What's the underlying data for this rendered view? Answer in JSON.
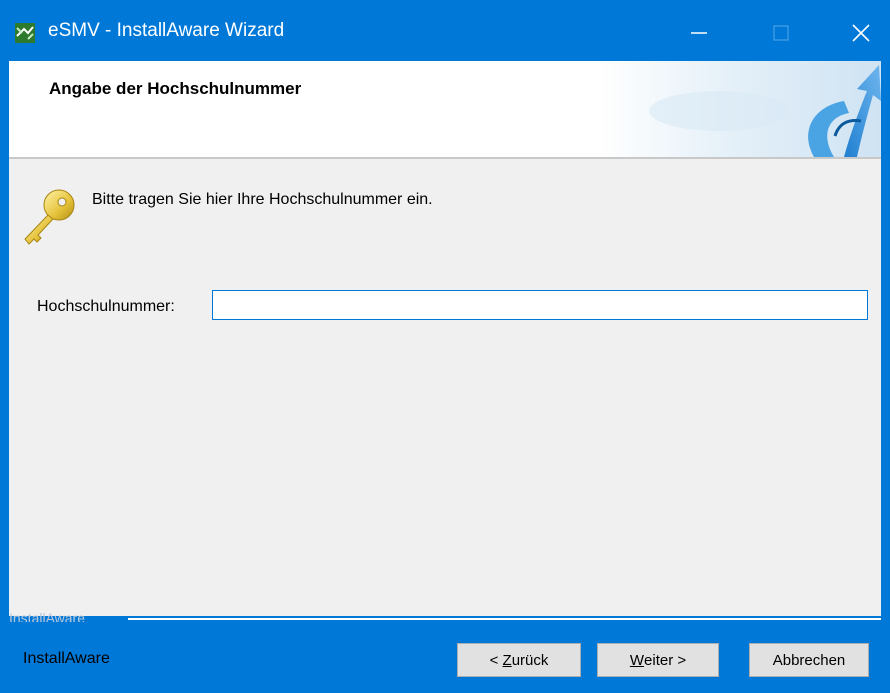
{
  "window": {
    "title": "eSMV - InstallAware Wizard",
    "accent_color": "#0078d7"
  },
  "header": {
    "title": "Angabe der Hochschulnummer"
  },
  "content": {
    "intro_text": "Bitte tragen Sie hier Ihre Hochschulnummer ein.",
    "field": {
      "label": "Hochschulnummer:",
      "value": "",
      "placeholder": ""
    }
  },
  "footer": {
    "brand_watermark": "InstallAware",
    "brand_label": "InstallAware",
    "buttons": {
      "back": {
        "prefix": "< ",
        "mnemonic": "Z",
        "rest": "urück"
      },
      "next": {
        "mnemonic": "W",
        "rest": "eiter",
        "suffix": " >"
      },
      "cancel": {
        "label": "Abbrechen"
      }
    }
  },
  "icons": {
    "app": "installer-icon",
    "minimize": "minimize-icon",
    "maximize": "maximize-icon",
    "close": "close-icon",
    "key": "key-icon",
    "banner": "installaware-arrow-logo"
  }
}
